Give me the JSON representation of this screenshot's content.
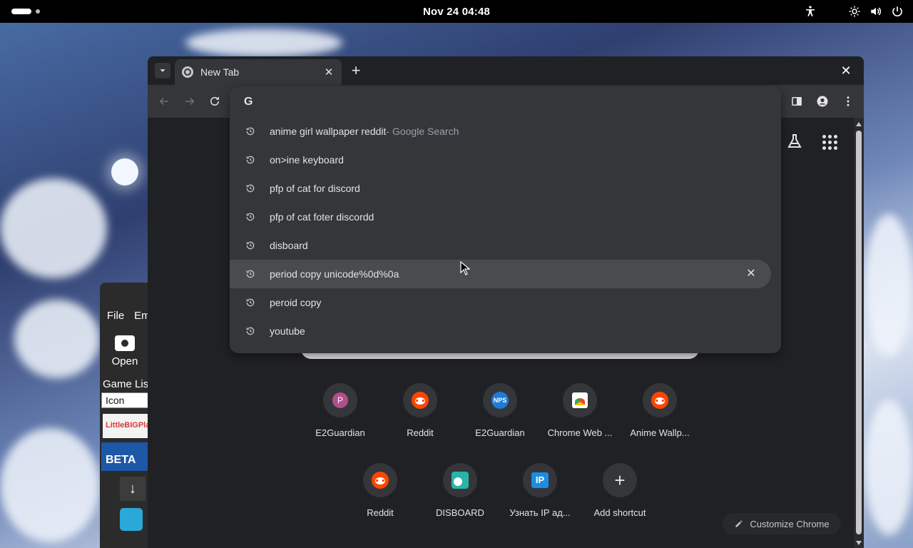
{
  "topbar": {
    "clock": "Nov 24  04:48"
  },
  "bg_app": {
    "menu_file": "File",
    "menu_edit": "Em",
    "open_label": "Open",
    "game_list": "Game List",
    "icon_column": "Icon",
    "thumb1_text": "LittleBIGPlan",
    "thumb2_text": "BETA"
  },
  "chrome": {
    "tab_title": "New Tab",
    "omnibox": {
      "suggestions": [
        {
          "text": "anime girl wallpaper reddit",
          "suffix": " - Google Search"
        },
        {
          "text": "on>ine keyboard",
          "suffix": ""
        },
        {
          "text": "pfp of cat for discord",
          "suffix": ""
        },
        {
          "text": "pfp of cat foter discordd",
          "suffix": ""
        },
        {
          "text": "disboard",
          "suffix": ""
        },
        {
          "text": "period copy unicode%0d%0a",
          "suffix": ""
        },
        {
          "text": "peroid copy",
          "suffix": ""
        },
        {
          "text": "youtube",
          "suffix": ""
        }
      ]
    },
    "shortcuts": [
      {
        "label": "E2Guardian",
        "icon_letter": "P"
      },
      {
        "label": "Reddit"
      },
      {
        "label": "E2Guardian",
        "icon_letter": "NPS"
      },
      {
        "label": "Chrome Web ..."
      },
      {
        "label": "Anime Wallp..."
      },
      {
        "label": "Reddit"
      },
      {
        "label": "DISBOARD"
      },
      {
        "label": "Узнать IP ад..."
      },
      {
        "label": "Add shortcut"
      }
    ],
    "customize_label": "Customize Chrome"
  },
  "colors": {
    "window_bg": "#202124",
    "toolbar_bg": "#35363a",
    "text": "#e3e3e3",
    "muted": "#9aa0a6"
  }
}
